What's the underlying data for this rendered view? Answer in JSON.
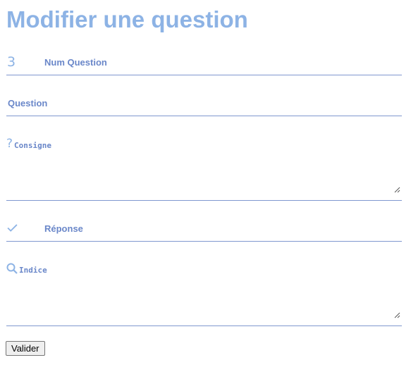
{
  "page": {
    "title": "Modifier une question"
  },
  "form": {
    "num_question": {
      "value": "3",
      "placeholder": "Num Question",
      "icon": "number-3-icon"
    },
    "question": {
      "placeholder": "Question"
    },
    "consigne": {
      "placeholder": "Consigne",
      "icon": "question-mark-icon"
    },
    "reponse": {
      "placeholder": "Réponse",
      "icon": "checkmark-icon"
    },
    "indice": {
      "placeholder": "Indice",
      "icon": "search-icon"
    },
    "submit_label": "Valider"
  },
  "colors": {
    "title": "#8db3e5",
    "label": "#6a87c9",
    "underline": "#7f97cf"
  }
}
